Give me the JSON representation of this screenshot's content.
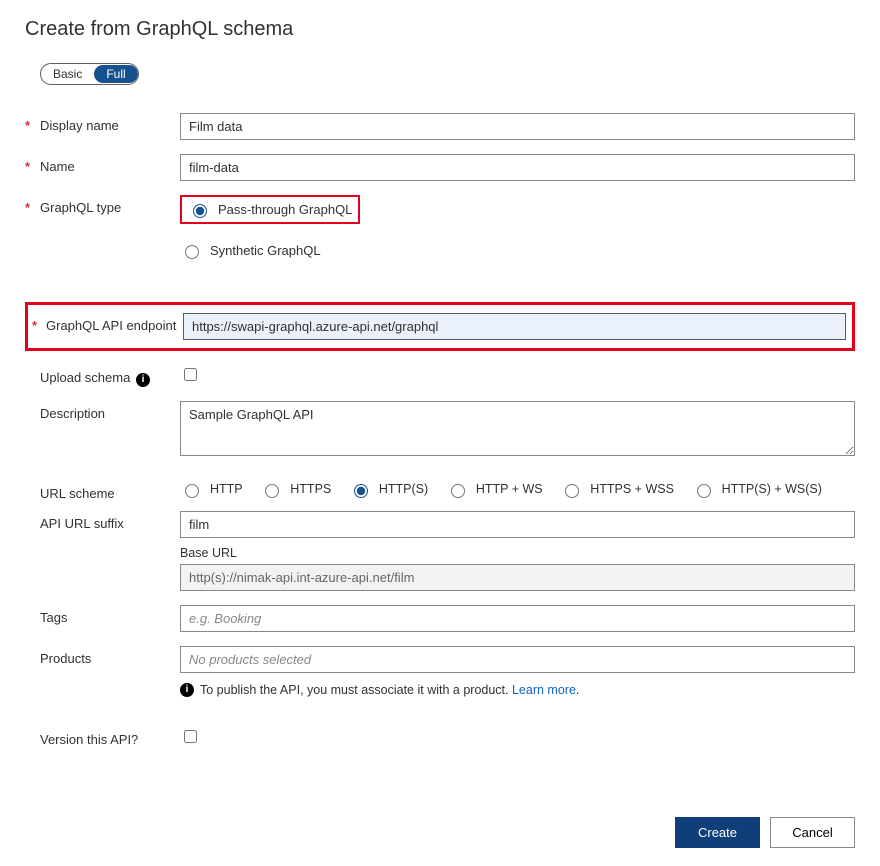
{
  "page_title": "Create from GraphQL schema",
  "toggle": {
    "basic": "Basic",
    "full": "Full",
    "active": "Full"
  },
  "fields": {
    "display_name": {
      "label": "Display name",
      "value": "Film data",
      "required": true
    },
    "name": {
      "label": "Name",
      "value": "film-data",
      "required": true
    },
    "graphql_type": {
      "label": "GraphQL type",
      "required": true,
      "options": {
        "pass": "Pass-through GraphQL",
        "synth": "Synthetic GraphQL"
      },
      "selected": "pass"
    },
    "endpoint": {
      "label": "GraphQL API endpoint",
      "value": "https://swapi-graphql.azure-api.net/graphql",
      "required": true
    },
    "upload_schema": {
      "label": "Upload schema",
      "checked": false
    },
    "description": {
      "label": "Description",
      "value": "Sample GraphQL API"
    },
    "url_scheme": {
      "label": "URL scheme",
      "options": [
        "HTTP",
        "HTTPS",
        "HTTP(S)",
        "HTTP + WS",
        "HTTPS + WSS",
        "HTTP(S) + WS(S)"
      ],
      "selected": "HTTP(S)"
    },
    "suffix": {
      "label": "API URL suffix",
      "value": "film"
    },
    "base_url": {
      "label": "Base URL",
      "value": "http(s)://nimak-api.int-azure-api.net/film"
    },
    "tags": {
      "label": "Tags",
      "placeholder": "e.g. Booking"
    },
    "products": {
      "label": "Products",
      "placeholder": "No products selected"
    },
    "publish_note": {
      "text": "To publish the API, you must associate it with a product. ",
      "link": "Learn more"
    },
    "version": {
      "label": "Version this API?",
      "checked": false
    }
  },
  "buttons": {
    "create": "Create",
    "cancel": "Cancel"
  }
}
